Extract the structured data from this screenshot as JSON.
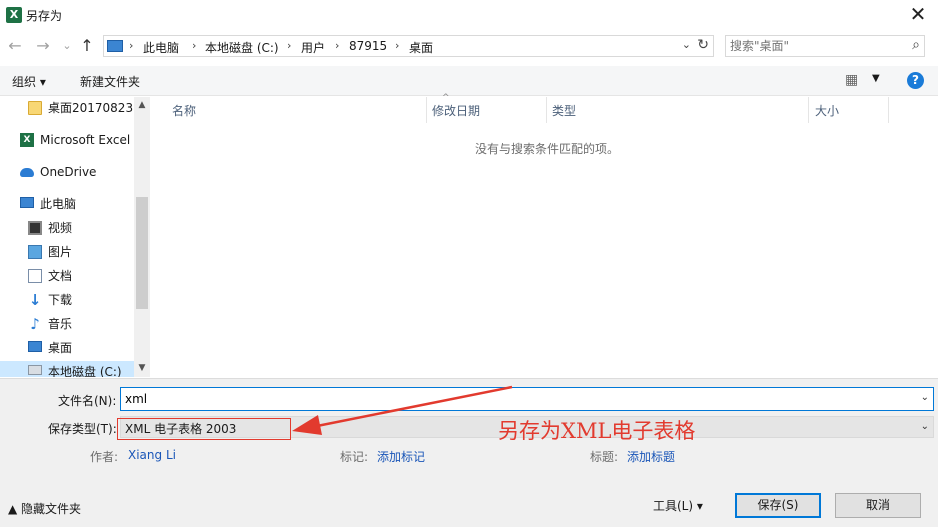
{
  "window": {
    "title": "另存为",
    "close_glyph": "✕",
    "app_icon_letter": "X"
  },
  "address": {
    "breadcrumbs": [
      "此电脑",
      "本地磁盘 (C:)",
      "用户",
      "87915",
      "桌面"
    ],
    "separator": "›",
    "back_glyph": "←",
    "forward_glyph": "→",
    "recent_glyph": "⌄",
    "up_glyph": "↑",
    "dropdown_glyph": "⌄",
    "refresh_glyph": "↻"
  },
  "search": {
    "placeholder": "搜索\"桌面\"",
    "icon": "magnifier-icon"
  },
  "toolbar": {
    "organize_label": "组织 ▾",
    "new_folder_label": "新建文件夹",
    "view_glyph": "▦",
    "view_dropdown_glyph": "▼",
    "help_glyph": "?"
  },
  "sidebar": {
    "items": [
      {
        "label": "桌面20170823",
        "icon": "folder-icon"
      },
      {
        "label": "Microsoft Excel",
        "icon": "excel-icon"
      },
      {
        "label": "OneDrive",
        "icon": "cloud-icon"
      },
      {
        "label": "此电脑",
        "icon": "computer-icon"
      },
      {
        "label": "视频",
        "icon": "video-icon"
      },
      {
        "label": "图片",
        "icon": "pictures-icon"
      },
      {
        "label": "文档",
        "icon": "documents-icon"
      },
      {
        "label": "下载",
        "icon": "download-icon"
      },
      {
        "label": "音乐",
        "icon": "music-icon"
      },
      {
        "label": "桌面",
        "icon": "desktop-icon"
      },
      {
        "label": "本地磁盘 (C:)",
        "icon": "disk-icon"
      }
    ],
    "scroll_up_glyph": "▲",
    "scroll_down_glyph": "▼"
  },
  "file_list": {
    "columns": [
      "名称",
      "修改日期",
      "类型",
      "大小"
    ],
    "sort_glyph": "^",
    "empty_message": "没有与搜索条件匹配的项。"
  },
  "form": {
    "filename_label": "文件名(N):",
    "filename_value": "xml",
    "filetype_label": "保存类型(T):",
    "filetype_value": "XML 电子表格 2003",
    "dropdown_glyph": "⌄",
    "author_label": "作者:",
    "author_value": "Xiang Li",
    "tags_label": "标记:",
    "tags_value": "添加标记",
    "title_label": "标题:",
    "title_value": "添加标题"
  },
  "footer": {
    "hide_folders_label": "▲ 隐藏文件夹",
    "tools_label": "工具(L)  ▾",
    "save_label": "保存(S)",
    "cancel_label": "取消"
  },
  "annotation": {
    "text": "另存为XML电子表格",
    "color": "#e23a2e"
  },
  "colors": {
    "accent": "#0078d7",
    "excel_green": "#1e7145",
    "link": "#1a56b8",
    "selection": "#cce8ff"
  }
}
